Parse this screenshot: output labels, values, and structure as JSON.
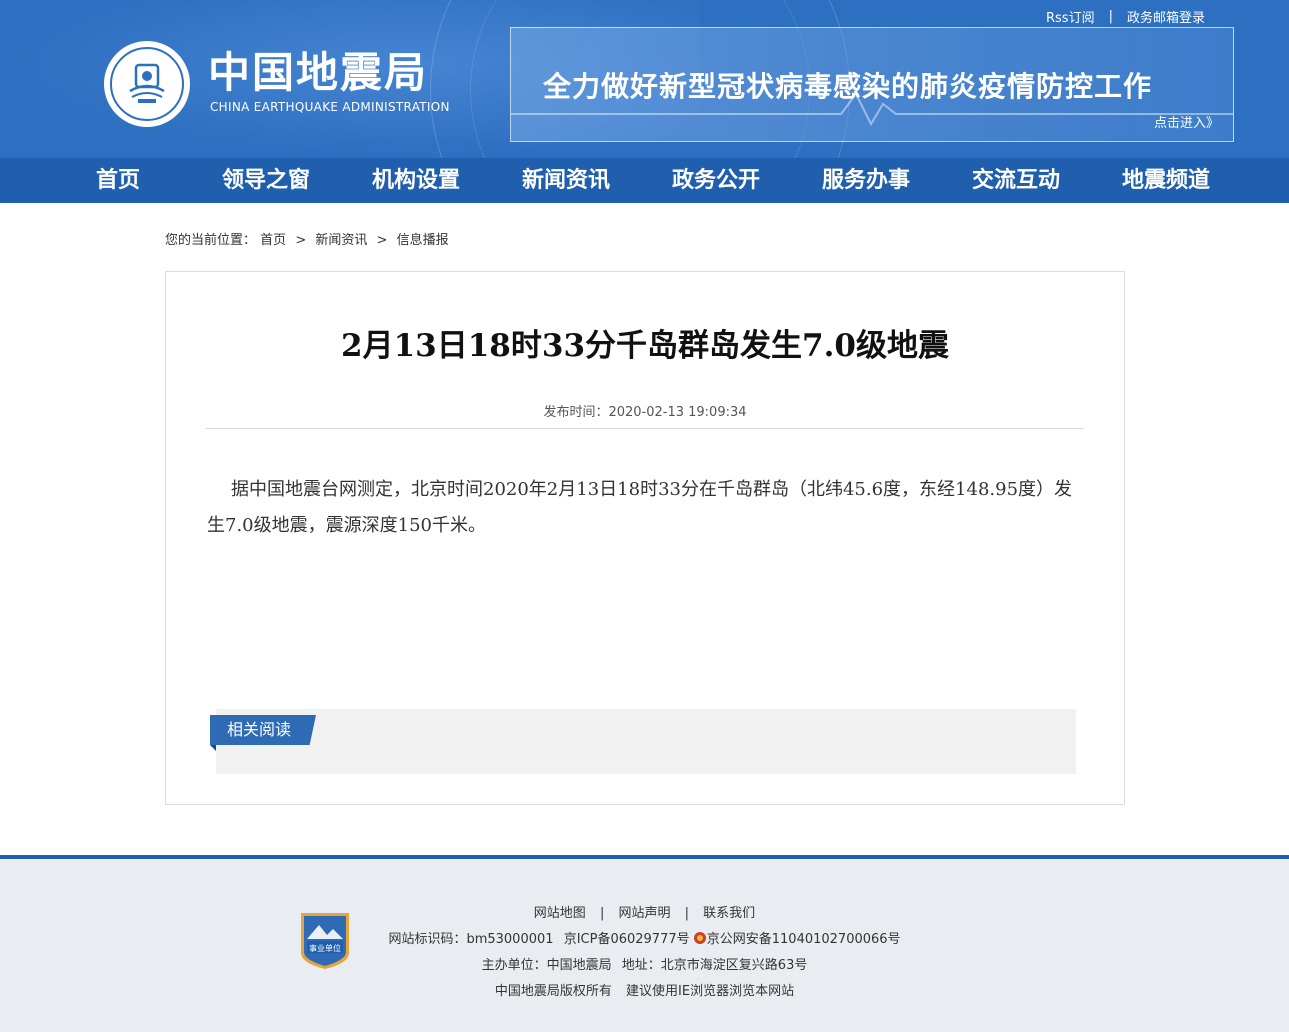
{
  "top_links": {
    "rss": "Rss订阅",
    "separator": "|",
    "mail": "政务邮箱登录"
  },
  "brand": {
    "name_cn": "中国地震局",
    "name_en": "CHINA EARTHQUAKE ADMINISTRATION"
  },
  "banner": {
    "title": "全力做好新型冠状病毒感染的肺炎疫情防控工作",
    "link": "点击进入》"
  },
  "nav": {
    "items": [
      "首页",
      "领导之窗",
      "机构设置",
      "新闻资讯",
      "政务公开",
      "服务办事",
      "交流互动",
      "地震频道"
    ]
  },
  "breadcrumb": {
    "prefix": "您的当前位置：",
    "home": "首页",
    "section": "新闻资讯",
    "current": "信息播报",
    "separator": ">"
  },
  "article": {
    "title": "2月13日18时33分千岛群岛发生7.0级地震",
    "publish_time": "发布时间：2020-02-13 19:09:34",
    "body": "据中国地震台网测定，北京时间2020年2月13日18时33分在千岛群岛（北纬45.6度，东经148.95度）发生7.0级地震，震源深度150千米。"
  },
  "related": {
    "label": "相关阅读"
  },
  "footer": {
    "links": [
      "网站地图",
      "网站声明",
      "联系我们"
    ],
    "separator": "|",
    "site_id": "网站标识码：bm53000001",
    "icp": "京ICP备06029777号",
    "police": "京公网安备11040102700066号",
    "host": "主办单位：中国地震局",
    "address": "地址：北京市海淀区复兴路63号",
    "copyright": "中国地震局版权所有",
    "browser_tip": "建议使用IE浏览器浏览本网站",
    "badge_text": "事业单位"
  },
  "colors": {
    "header_blue": "#2d6fc0",
    "nav_blue": "#1f5fae",
    "tag_blue": "#2f6bb5",
    "footer_bg": "#e9edf2"
  }
}
